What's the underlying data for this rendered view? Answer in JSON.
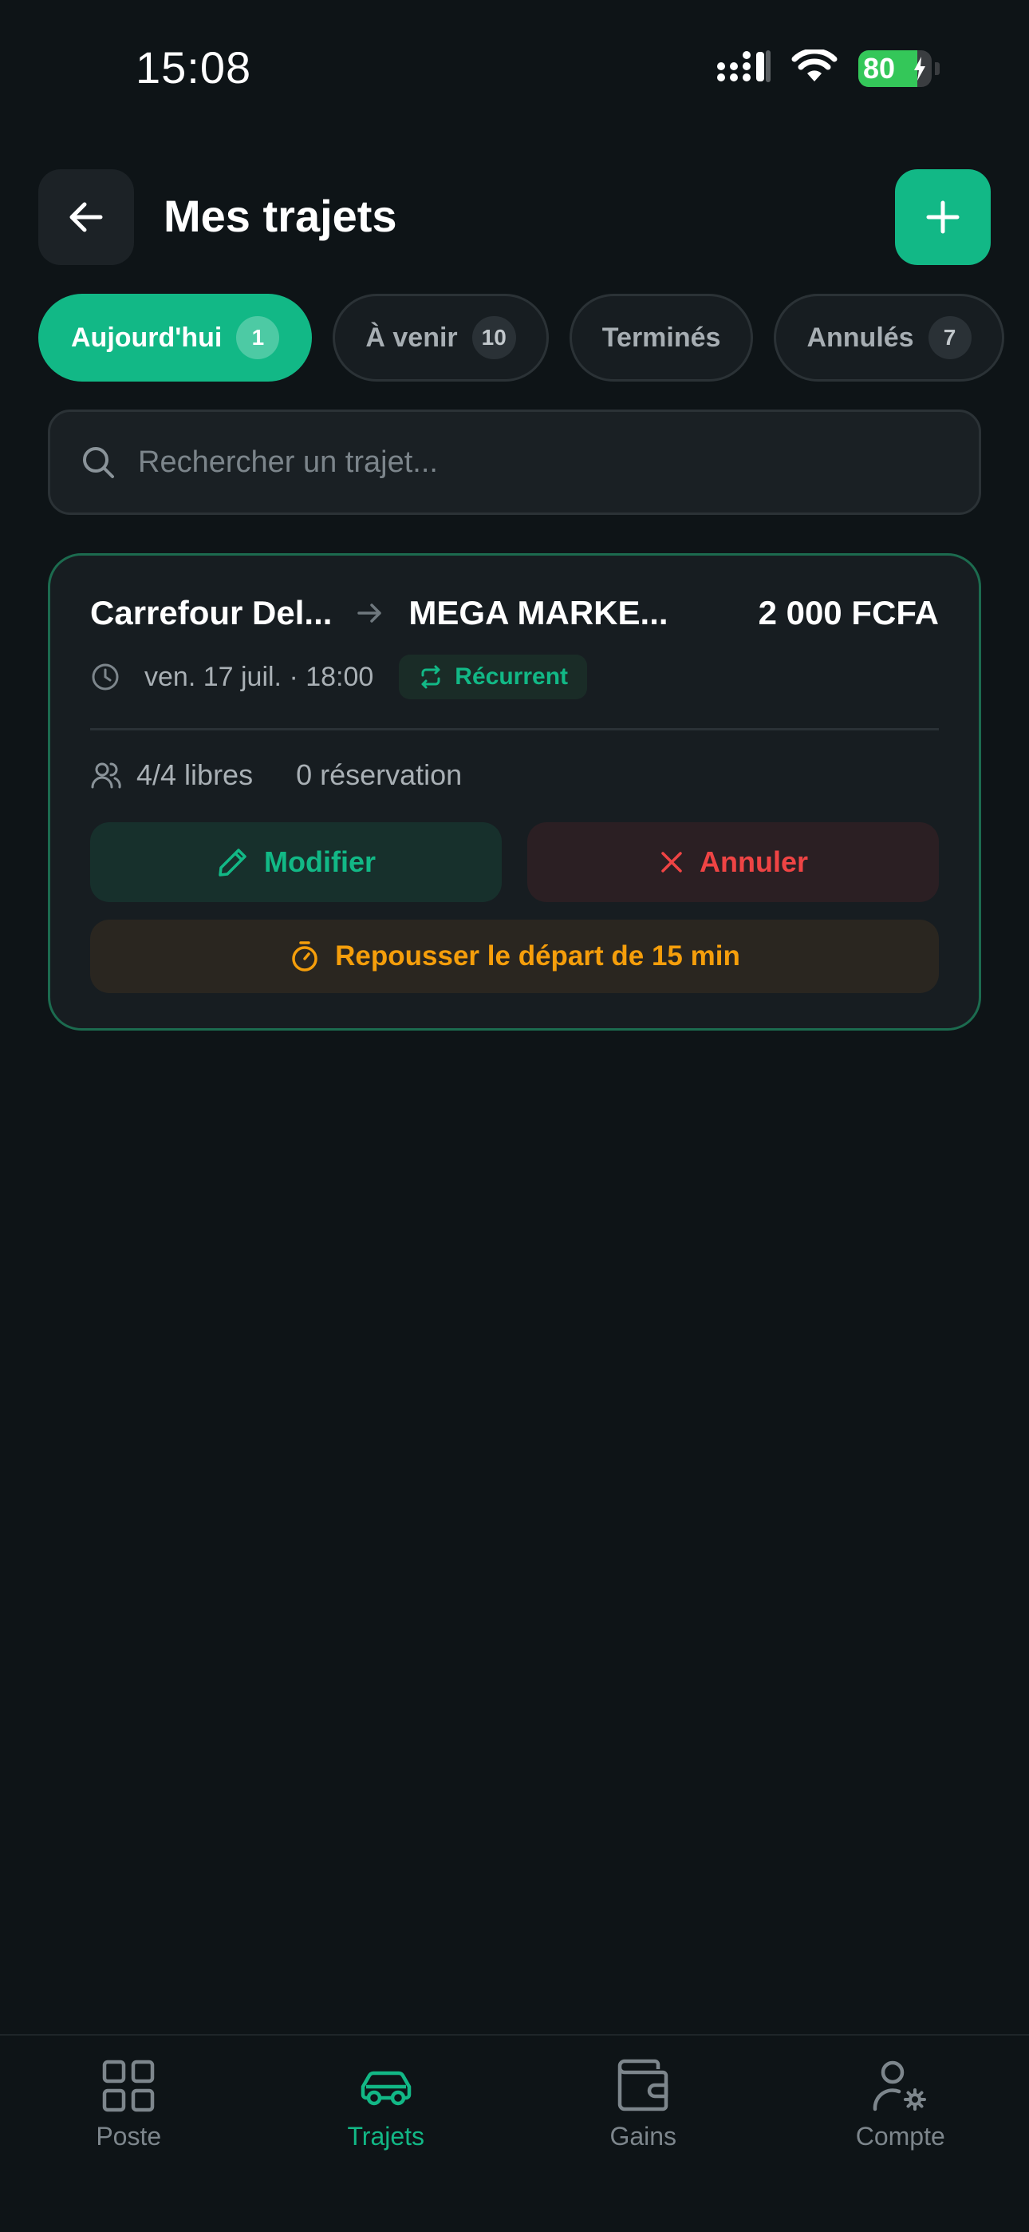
{
  "status_bar": {
    "time": "15:08",
    "battery": "80",
    "battery_level": 0.8
  },
  "header": {
    "title": "Mes trajets",
    "back_icon": "arrow-left-icon",
    "add_icon": "plus-icon"
  },
  "tabs": [
    {
      "label": "Aujourd'hui",
      "count": "1",
      "active": true
    },
    {
      "label": "À venir",
      "count": "10",
      "active": false
    },
    {
      "label": "Terminés",
      "count": "",
      "active": false
    },
    {
      "label": "Annulés",
      "count": "7",
      "active": false
    }
  ],
  "search": {
    "placeholder": "Rechercher un trajet..."
  },
  "trip": {
    "from": "Carrefour Del...",
    "to": "MEGA MARKE...",
    "price": "2 000 FCFA",
    "datetime": "ven. 17 juil. · 18:00",
    "recurring_label": "Récurrent",
    "seats": "4/4 libres",
    "reservations": "0 réservation",
    "edit_label": "Modifier",
    "cancel_label": "Annuler",
    "delay_label": "Repousser le départ de 15 min"
  },
  "bottom_nav": [
    {
      "label": "Poste",
      "icon": "grid-icon",
      "active": false
    },
    {
      "label": "Trajets",
      "icon": "car-icon",
      "active": true
    },
    {
      "label": "Gains",
      "icon": "wallet-icon",
      "active": false
    },
    {
      "label": "Compte",
      "icon": "user-settings-icon",
      "active": false
    }
  ],
  "colors": {
    "background": "#0e1417",
    "accent": "#12b886",
    "danger": "#ef4444",
    "warning": "#f59e0b"
  }
}
